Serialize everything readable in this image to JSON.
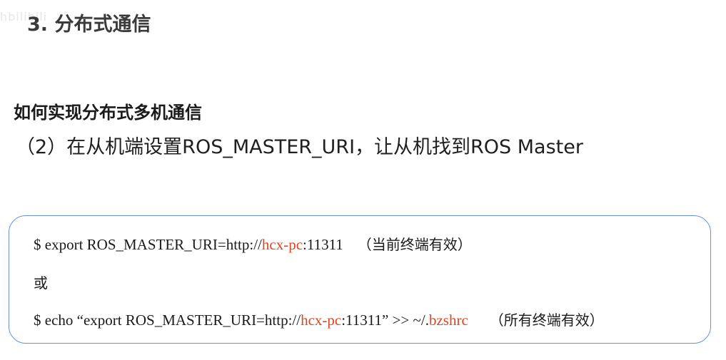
{
  "watermark": "hbilibili",
  "section_title": "3. 分布式通信",
  "heading": "如何实现分布式多机通信",
  "step": "（2）在从机端设置ROS_MASTER_URI，让从机找到ROS Master",
  "commands": {
    "cmd1": {
      "prefix": "$ export ROS_MASTER_URI=http://",
      "host": "hcx-pc",
      "port": ":11311",
      "note": "（当前终端有效）"
    },
    "or_label": "或",
    "cmd2": {
      "prefix": "$ echo “export ROS_MASTER_URI=http://",
      "host": "hcx-pc",
      "suffix": ":11311” >> ~/.",
      "file": "bzshrc",
      "note": "（所有终端有效）"
    }
  },
  "colors": {
    "highlight": "#e0441e",
    "box_border": "#6b8fd6"
  }
}
